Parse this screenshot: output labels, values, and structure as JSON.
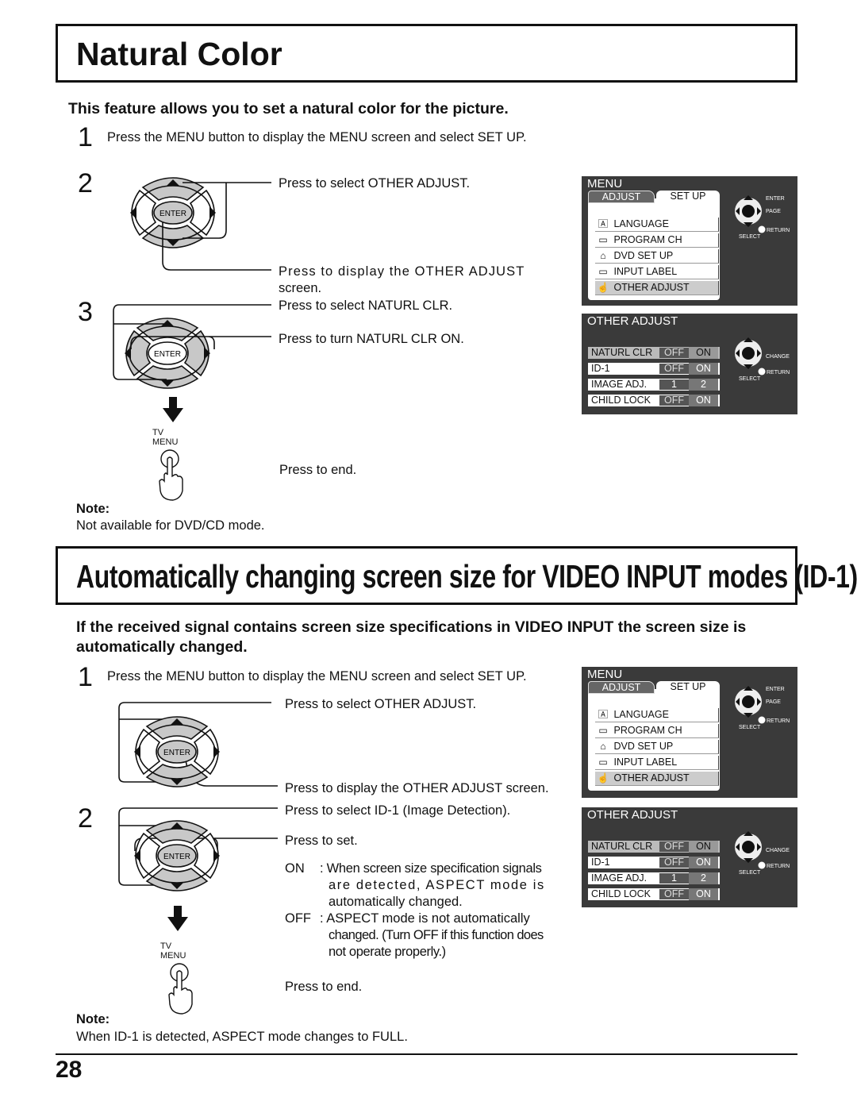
{
  "section1": {
    "title": "Natural Color",
    "subtitle": "This feature allows you to set a natural color for the picture.",
    "step1": {
      "num": "1",
      "text": "Press the MENU button to display the MENU screen and select SET UP."
    },
    "step2": {
      "num": "2",
      "select": "Press to select OTHER ADJUST.",
      "display_line1": "Press to display the OTHER ADJUST",
      "display_line2": "screen."
    },
    "step3": {
      "num": "3",
      "select": "Press to select NATURL CLR.",
      "turn_on": "Press to turn NATURL CLR ON."
    },
    "tv_label": "TV",
    "menu_label": "MENU",
    "end": "Press to end.",
    "note_label": "Note:",
    "note_text": "Not available for DVD/CD mode."
  },
  "section2": {
    "title": "Automatically changing screen size for VIDEO INPUT modes (ID-1)",
    "intro_line1": "If the received signal contains screen size specifications in VIDEO INPUT the screen size is",
    "intro_line2": "automatically changed.",
    "step1": {
      "num": "1",
      "text": "Press the MENU button to display the MENU screen and select SET UP."
    },
    "step2": {
      "num": "2",
      "select": "Press to select OTHER ADJUST.",
      "display": "Press to display the OTHER ADJUST screen.",
      "select_id": "Press to select  ID-1 (Image Detection).",
      "set": "Press to set."
    },
    "on_key": "ON",
    "on_line1": ": When screen size specification signals",
    "on_line2": "are detected, ASPECT mode is",
    "on_line3": "automatically changed.",
    "off_key": "OFF",
    "off_line1": ": ASPECT mode is not automatically",
    "off_line2": "changed. (Turn OFF if this function does",
    "off_line3": "not operate properly.)",
    "tv_label": "TV",
    "menu_label": "MENU",
    "end": "Press to end.",
    "note_label": "Note:",
    "note_text": "When ID-1 is detected, ASPECT mode changes to FULL."
  },
  "remote": {
    "enter": "ENTER"
  },
  "menu_screen": {
    "title": "MENU",
    "tab_adjust": "ADJUST",
    "tab_setup": "SET UP",
    "items": [
      {
        "icon": "language-icon",
        "glyph": "🄰",
        "label": "LANGUAGE"
      },
      {
        "icon": "program-ch-icon",
        "glyph": "▭",
        "label": "PROGRAM  CH"
      },
      {
        "icon": "dvd-setup-icon",
        "glyph": "⌂",
        "label": "DVD  SET  UP"
      },
      {
        "icon": "input-label-icon",
        "glyph": "▭",
        "label": "INPUT  LABEL"
      },
      {
        "icon": "other-adjust-icon",
        "glyph": "☝",
        "label": "OTHER  ADJUST",
        "selected": true
      }
    ],
    "enter": "ENTER",
    "page": "PAGE",
    "return": "RETURN",
    "select": "SELECT"
  },
  "other_adjust_screen": {
    "title": "OTHER ADJUST",
    "rows": [
      {
        "label": "NATURL CLR",
        "a": "OFF",
        "b": "ON",
        "selected": true
      },
      {
        "label": "ID-1",
        "a": "OFF",
        "b": "ON"
      },
      {
        "label": "IMAGE ADJ.",
        "a": "1",
        "b": "2"
      },
      {
        "label": "CHILD LOCK",
        "a": "OFF",
        "b": "ON"
      }
    ],
    "change": "CHANGE",
    "return": "RETURN",
    "select": "SELECT"
  },
  "page_number": "28"
}
